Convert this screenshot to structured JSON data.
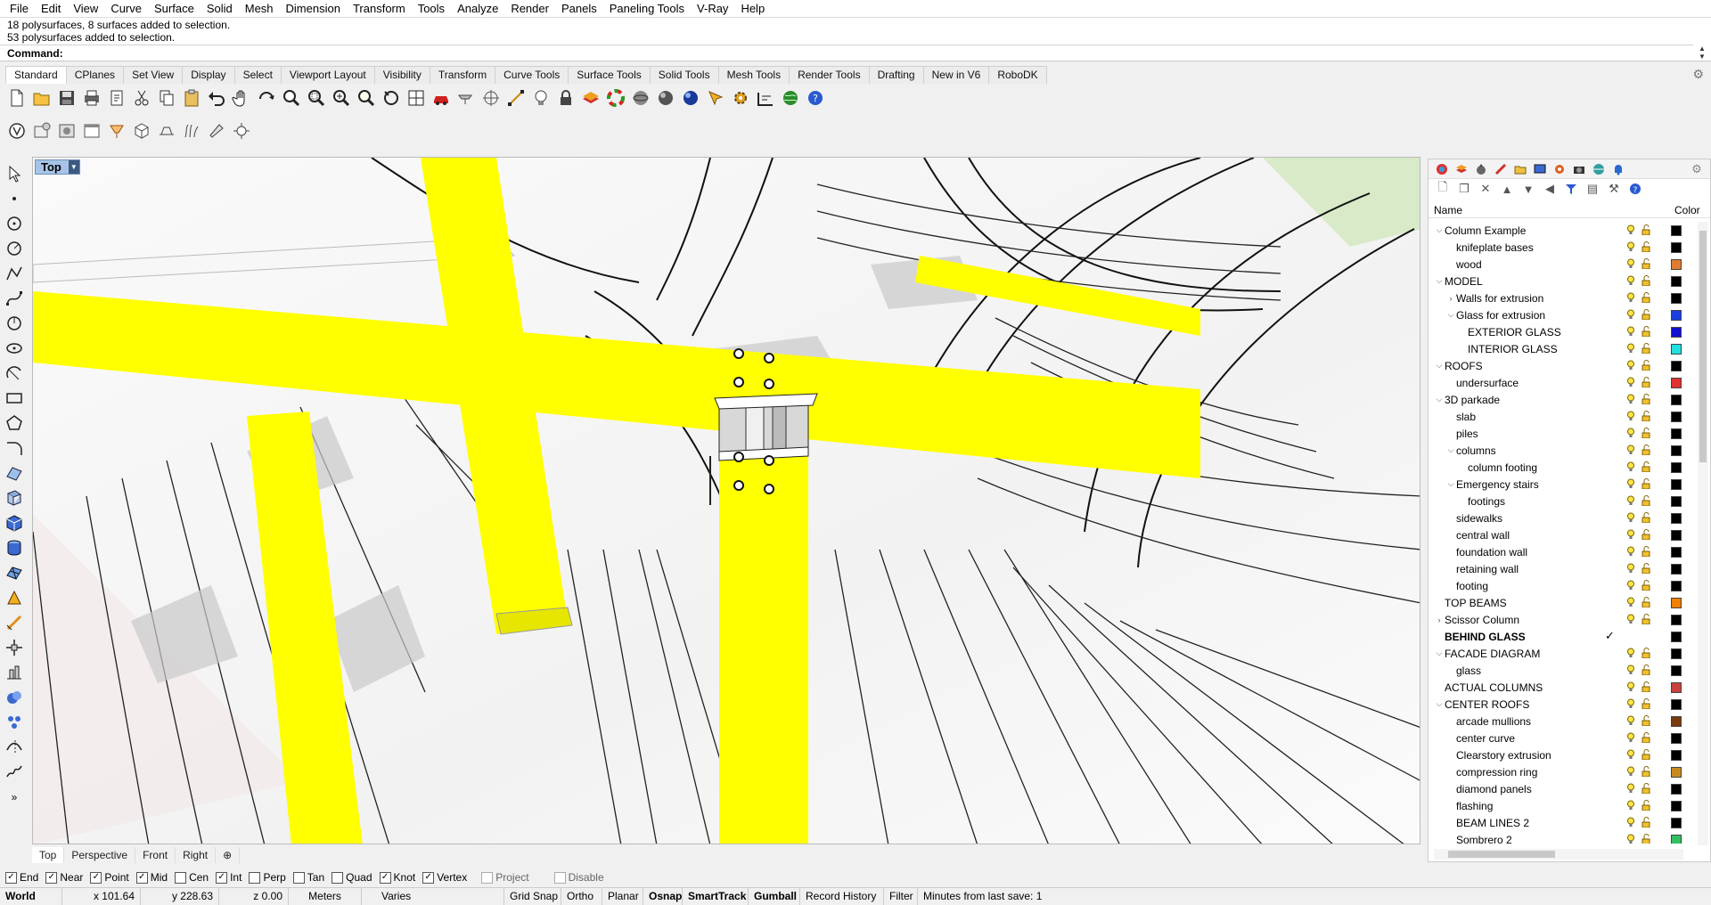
{
  "menu": [
    "File",
    "Edit",
    "View",
    "Curve",
    "Surface",
    "Solid",
    "Mesh",
    "Dimension",
    "Transform",
    "Tools",
    "Analyze",
    "Render",
    "Panels",
    "Paneling Tools",
    "V-Ray",
    "Help"
  ],
  "history": {
    "line1": "18 polysurfaces, 8 surfaces added to selection.",
    "line2": "53 polysurfaces added to selection."
  },
  "command": {
    "label": "Command:",
    "value": ""
  },
  "toolbar_tabs": [
    "Standard",
    "CPlanes",
    "Set View",
    "Display",
    "Select",
    "Viewport Layout",
    "Visibility",
    "Transform",
    "Curve Tools",
    "Surface Tools",
    "Solid Tools",
    "Mesh Tools",
    "Render Tools",
    "Drafting",
    "New in V6",
    "RoboDK"
  ],
  "toolbar_active_tab": "Standard",
  "viewport": {
    "name": "Top",
    "highlight_color": "#ffff00"
  },
  "view_tabs": [
    "Top",
    "Perspective",
    "Front",
    "Right"
  ],
  "osnaps": [
    {
      "label": "End",
      "checked": true
    },
    {
      "label": "Near",
      "checked": true
    },
    {
      "label": "Point",
      "checked": true
    },
    {
      "label": "Mid",
      "checked": true
    },
    {
      "label": "Cen",
      "checked": false
    },
    {
      "label": "Int",
      "checked": true
    },
    {
      "label": "Perp",
      "checked": false
    },
    {
      "label": "Tan",
      "checked": false
    },
    {
      "label": "Quad",
      "checked": false
    },
    {
      "label": "Knot",
      "checked": true
    },
    {
      "label": "Vertex",
      "checked": true
    },
    {
      "label": "Project",
      "checked": false,
      "disabled": true
    },
    {
      "label": "Disable",
      "checked": false,
      "disabled": true
    }
  ],
  "status": {
    "cplane": "World",
    "x": "x 101.64",
    "y": "y 228.63",
    "z": "z 0.00",
    "units": "Meters",
    "layer": "Varies",
    "grid_snap": "Grid Snap",
    "ortho": "Ortho",
    "planar": "Planar",
    "osnap": "Osnap",
    "smarttrack": "SmartTrack",
    "gumball": "Gumball",
    "record_history": "Record History",
    "filter": "Filter",
    "save_info": "Minutes from last save: 1"
  },
  "layers_panel": {
    "header_name": "Name",
    "header_color": "Color",
    "layers": [
      {
        "name": "Column Example",
        "indent": 0,
        "chevron": "open",
        "color": "#000000"
      },
      {
        "name": "knifeplate bases",
        "indent": 1,
        "chevron": "none",
        "color": "#000000"
      },
      {
        "name": "wood",
        "indent": 1,
        "chevron": "none",
        "color": "#e07b30"
      },
      {
        "name": "MODEL",
        "indent": 0,
        "chevron": "open",
        "color": "#000000"
      },
      {
        "name": "Walls for extrusion",
        "indent": 1,
        "chevron": "closed",
        "color": "#000000"
      },
      {
        "name": "Glass for extrusion",
        "indent": 1,
        "chevron": "open",
        "color": "#1a3fe0"
      },
      {
        "name": "EXTERIOR GLASS",
        "indent": 2,
        "chevron": "none",
        "color": "#1010d0"
      },
      {
        "name": "INTERIOR GLASS",
        "indent": 2,
        "chevron": "none",
        "color": "#20e0e0"
      },
      {
        "name": "ROOFS",
        "indent": 0,
        "chevron": "open",
        "color": "#000000"
      },
      {
        "name": "undersurface",
        "indent": 1,
        "chevron": "none",
        "color": "#e03030"
      },
      {
        "name": "3D parkade",
        "indent": 0,
        "chevron": "open",
        "color": "#000000"
      },
      {
        "name": "slab",
        "indent": 1,
        "chevron": "none",
        "color": "#000000"
      },
      {
        "name": "piles",
        "indent": 1,
        "chevron": "none",
        "color": "#000000"
      },
      {
        "name": "columns",
        "indent": 1,
        "chevron": "open",
        "color": "#000000"
      },
      {
        "name": "column footing",
        "indent": 2,
        "chevron": "none",
        "color": "#000000"
      },
      {
        "name": "Emergency stairs",
        "indent": 1,
        "chevron": "open",
        "color": "#000000"
      },
      {
        "name": "footings",
        "indent": 2,
        "chevron": "none",
        "color": "#000000"
      },
      {
        "name": "sidewalks",
        "indent": 1,
        "chevron": "none",
        "color": "#000000"
      },
      {
        "name": "central wall",
        "indent": 1,
        "chevron": "none",
        "color": "#000000"
      },
      {
        "name": "foundation wall",
        "indent": 1,
        "chevron": "none",
        "color": "#000000"
      },
      {
        "name": "retaining wall",
        "indent": 1,
        "chevron": "none",
        "color": "#000000"
      },
      {
        "name": "footing",
        "indent": 1,
        "chevron": "none",
        "color": "#000000"
      },
      {
        "name": "TOP BEAMS",
        "indent": 0,
        "chevron": "none",
        "color": "#f08000"
      },
      {
        "name": "Scissor Column",
        "indent": 0,
        "chevron": "closed",
        "color": "#000000"
      },
      {
        "name": "BEHIND GLASS",
        "indent": 0,
        "chevron": "none",
        "color": "#000000",
        "current": true
      },
      {
        "name": "FACADE DIAGRAM",
        "indent": 0,
        "chevron": "open",
        "color": "#000000"
      },
      {
        "name": "glass",
        "indent": 1,
        "chevron": "none",
        "color": "#000000"
      },
      {
        "name": "ACTUAL COLUMNS",
        "indent": 0,
        "chevron": "none",
        "color": "#c84040"
      },
      {
        "name": "CENTER ROOFS",
        "indent": 0,
        "chevron": "open",
        "color": "#000000"
      },
      {
        "name": "arcade mullions",
        "indent": 1,
        "chevron": "none",
        "color": "#7a3a10"
      },
      {
        "name": "center curve",
        "indent": 1,
        "chevron": "none",
        "color": "#000000"
      },
      {
        "name": "Clearstory extrusion",
        "indent": 1,
        "chevron": "none",
        "color": "#000000"
      },
      {
        "name": "compression ring",
        "indent": 1,
        "chevron": "none",
        "color": "#c88a20"
      },
      {
        "name": "diamond panels",
        "indent": 1,
        "chevron": "none",
        "color": "#000000"
      },
      {
        "name": "flashing",
        "indent": 1,
        "chevron": "none",
        "color": "#000000"
      },
      {
        "name": "BEAM LINES 2",
        "indent": 1,
        "chevron": "none",
        "color": "#000000"
      },
      {
        "name": "Sombrero 2",
        "indent": 1,
        "chevron": "none",
        "color": "#30c060"
      }
    ]
  }
}
